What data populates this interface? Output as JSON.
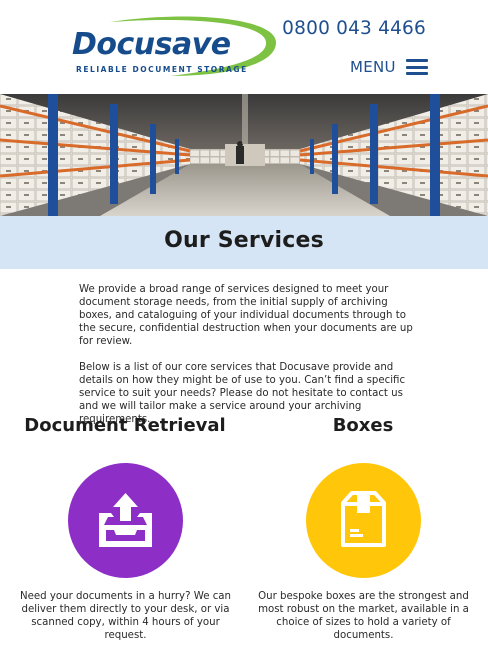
{
  "header": {
    "logo_name": "Docusave",
    "logo_tagline": "RELIABLE DOCUMENT STORAGE",
    "phone": "0800 043 4466",
    "menu_label": "MENU"
  },
  "hero": {
    "icon": "warehouse-photo"
  },
  "page": {
    "title": "Our Services",
    "intro": [
      "We provide a broad range of services designed to meet your document storage needs, from the initial supply of archiving boxes, and cataloguing of your individual documents through to the secure, confidential destruction when your documents are up for review.",
      "Below is a list of our core services that Docusave provide and details on how they might be of use to you. Can’t find a specific service to suit your needs? Please do not hesitate to contact us and we will tailor make a service around your archiving requirements."
    ]
  },
  "services": [
    {
      "title": "Document Retrieval",
      "icon": "tray-upload-icon",
      "color": "#8d2fc6",
      "description": "Need your documents in a hurry? We can deliver them directly to your desk, or via scanned copy, within 4 hours of your request."
    },
    {
      "title": "Boxes",
      "icon": "box-icon",
      "color": "#ffc60a",
      "description": "Our bespoke boxes are the strongest and most robust on the market, available in a choice of sizes to hold a variety of documents."
    }
  ],
  "colors": {
    "brand_blue": "#174c8c",
    "brand_green": "#7dc242",
    "band": "#d6e5f5"
  }
}
